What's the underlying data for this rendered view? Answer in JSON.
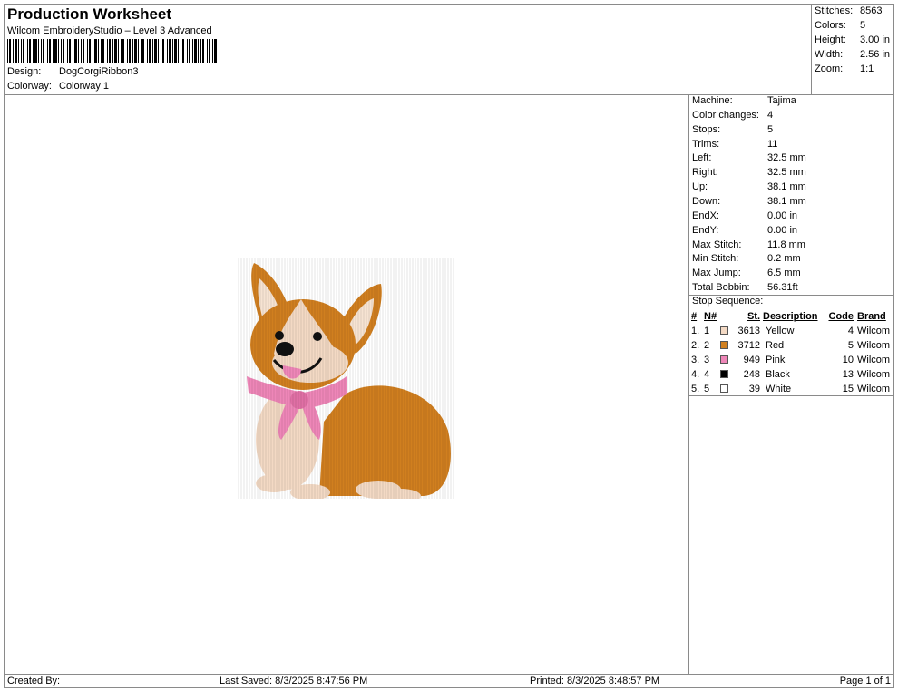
{
  "header": {
    "title": "Production Worksheet",
    "subtitle": "Wilcom EmbroideryStudio – Level 3 Advanced",
    "design_label": "Design:",
    "design_value": "DogCorgiRibbon3",
    "colorway_label": "Colorway:",
    "colorway_value": "Colorway 1"
  },
  "summary": [
    {
      "label": "Stitches:",
      "value": "8563"
    },
    {
      "label": "Colors:",
      "value": "5"
    },
    {
      "label": "Height:",
      "value": "3.00 in"
    },
    {
      "label": "Width:",
      "value": "2.56 in"
    },
    {
      "label": "Zoom:",
      "value": "1:1"
    }
  ],
  "machine_info": [
    {
      "label": "Machine:",
      "value": "Tajima"
    },
    {
      "label": "Color changes:",
      "value": "4"
    },
    {
      "label": "Stops:",
      "value": "5"
    },
    {
      "label": "Trims:",
      "value": "11"
    },
    {
      "label": "Left:",
      "value": "32.5 mm"
    },
    {
      "label": "Right:",
      "value": "32.5 mm"
    },
    {
      "label": "Up:",
      "value": "38.1 mm"
    },
    {
      "label": "Down:",
      "value": "38.1 mm"
    },
    {
      "label": "EndX:",
      "value": "0.00 in"
    },
    {
      "label": "EndY:",
      "value": "0.00 in"
    },
    {
      "label": "Max Stitch:",
      "value": "11.8 mm"
    },
    {
      "label": "Min Stitch:",
      "value": "0.2 mm"
    },
    {
      "label": "Max Jump:",
      "value": "6.5 mm"
    },
    {
      "label": "Total Bobbin:",
      "value": "56.31ft"
    }
  ],
  "stop_sequence": {
    "label": "Stop Sequence:",
    "headers": {
      "idx": "#",
      "num": "N#",
      "st": "St.",
      "desc": "Description",
      "code": "Code",
      "brand": "Brand"
    },
    "rows": [
      {
        "idx": "1.",
        "num": "1",
        "color": "#f3d9c4",
        "st": "3613",
        "desc": "Yellow",
        "code": "4",
        "brand": "Wilcom"
      },
      {
        "idx": "2.",
        "num": "2",
        "color": "#d07f1f",
        "st": "3712",
        "desc": "Red",
        "code": "5",
        "brand": "Wilcom"
      },
      {
        "idx": "3.",
        "num": "3",
        "color": "#ee86b8",
        "st": "949",
        "desc": "Pink",
        "code": "10",
        "brand": "Wilcom"
      },
      {
        "idx": "4.",
        "num": "4",
        "color": "#000000",
        "st": "248",
        "desc": "Black",
        "code": "13",
        "brand": "Wilcom"
      },
      {
        "idx": "5.",
        "num": "5",
        "color": "#ffffff",
        "st": "39",
        "desc": "White",
        "code": "15",
        "brand": "Wilcom"
      }
    ]
  },
  "footer": {
    "created_by": "Created By:",
    "last_saved": "Last Saved: 8/3/2025 8:47:56 PM",
    "printed": "Printed: 8/3/2025 8:48:57 PM",
    "page": "Page 1 of 1"
  }
}
